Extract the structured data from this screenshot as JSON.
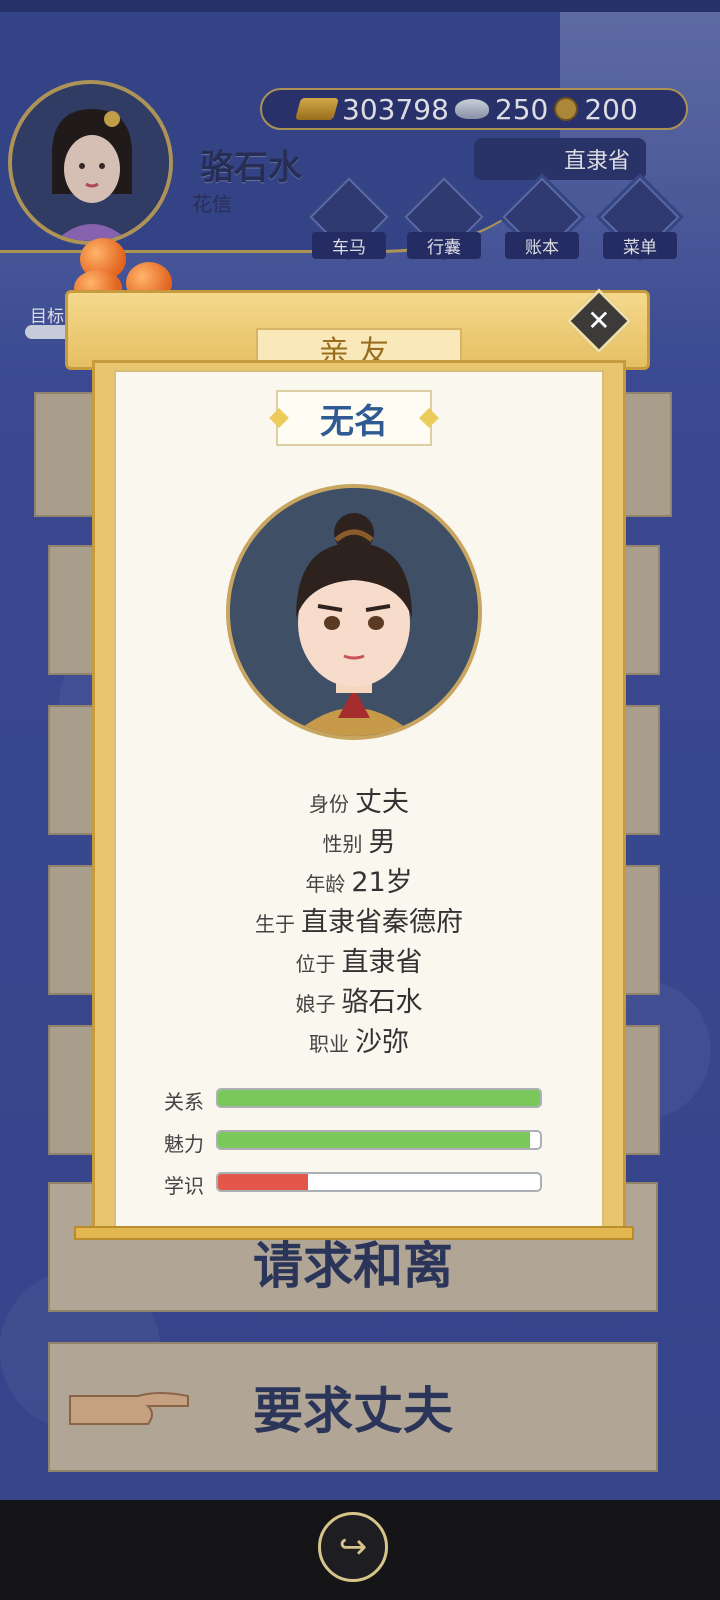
{
  "player": {
    "name": "骆石水",
    "subtitle": "花信"
  },
  "currency": {
    "gold": "303798",
    "silver": "250",
    "coins": "200"
  },
  "location": "直隶省",
  "nav": [
    {
      "label": "车马",
      "icon": "carriage-icon"
    },
    {
      "label": "行囊",
      "icon": "bag-icon"
    },
    {
      "label": "账本",
      "icon": "ledger-icon"
    },
    {
      "label": "菜单",
      "icon": "menu-icon"
    }
  ],
  "goal_label": "目标",
  "background_buttons": {
    "divorce": "请求和离",
    "request_husband": "要求丈夫"
  },
  "popup": {
    "title": "亲友",
    "name": "无名",
    "info": [
      {
        "key": "身份",
        "value": "丈夫"
      },
      {
        "key": "性别",
        "value": "男"
      },
      {
        "key": "年龄",
        "value": "21岁"
      },
      {
        "key": "生于",
        "value": "直隶省秦德府"
      },
      {
        "key": "位于",
        "value": "直隶省"
      },
      {
        "key": "娘子",
        "value": "骆石水"
      },
      {
        "key": "职业",
        "value": "沙弥"
      }
    ],
    "stats": [
      {
        "label": "关系",
        "fraction": 1.0,
        "color": "#7cc75a"
      },
      {
        "label": "魅力",
        "fraction": 0.97,
        "color": "#7cc75a"
      },
      {
        "label": "学识",
        "fraction": 0.28,
        "color": "#e2574a"
      }
    ]
  },
  "colors": {
    "accent_gold": "#e5bf63",
    "name_blue": "#2f5a94",
    "panel_bg": "#faf7ee"
  }
}
